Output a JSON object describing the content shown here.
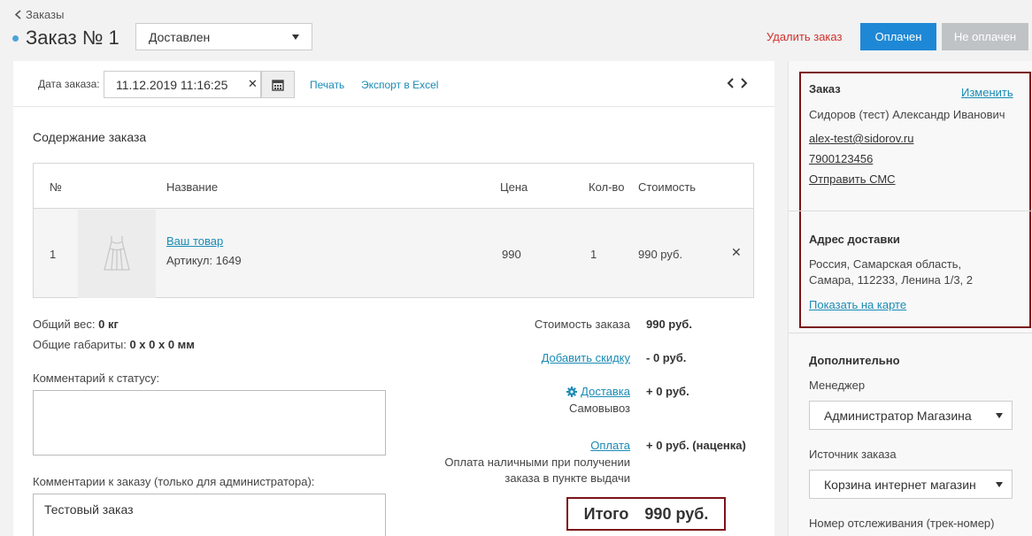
{
  "header": {
    "back_label": "Заказы",
    "title": "Заказ № 1",
    "status_value": "Доставлен",
    "delete_label": "Удалить заказ",
    "paid_label": "Оплачен",
    "unpaid_label": "Не оплачен"
  },
  "toolbar": {
    "date_label": "Дата заказа:",
    "date_value": "11.12.2019 11:16:25",
    "clear_glyph": "✕",
    "print_label": "Печать",
    "excel_label": "Экспорт в Excel"
  },
  "items": {
    "section_title": "Содержание заказа",
    "columns": [
      "№",
      "Название",
      "Цена",
      "Кол-во",
      "Стоимость"
    ],
    "rows": [
      {
        "num": "1",
        "name": "Ваш товар",
        "sku": "Артикул: 1649",
        "price": "990",
        "qty": "1",
        "cost": "990 руб."
      }
    ],
    "remove_glyph": "✕"
  },
  "meta": {
    "weight_label": "Общий вес:",
    "weight_value": "0 кг",
    "dims_label": "Общие габариты:",
    "dims_value": "0 x 0 x 0 мм",
    "status_comment_label": "Комментарий к статусу:",
    "admin_comment_label": "Комментарии к заказу (только для администратора):",
    "admin_comment_value": "Тестовый заказ"
  },
  "summary": {
    "order_cost_label": "Стоимость заказа",
    "order_cost_value": "990 руб.",
    "discount_label": "Добавить скидку",
    "discount_value": "- 0 руб.",
    "delivery_label": "Доставка",
    "delivery_value": "+ 0 руб.",
    "delivery_method": "Самовывоз",
    "payment_label": "Оплата",
    "payment_value": "+ 0 руб. (наценка)",
    "payment_method_line1": "Оплата наличными при получении",
    "payment_method_line2": "заказа в пункте выдачи",
    "total_label": "Итого",
    "total_value": "990 руб."
  },
  "customer": {
    "head": "Заказ",
    "edit_label": "Изменить",
    "name": "Сидоров (тест) Александр Иванович",
    "email": "alex-test@sidorov.ru",
    "phone": "7900123456",
    "sms_label": "Отправить СМС"
  },
  "address": {
    "head": "Адрес доставки",
    "line1": "Россия, Самарская область,",
    "line2": "Самара, 112233, Ленина 1/3, 2",
    "map_label": "Показать на карте"
  },
  "extra": {
    "head": "Дополнительно",
    "manager_label": "Менеджер",
    "manager_value": "Администратор Магазина",
    "source_label": "Источник заказа",
    "source_value": "Корзина интернет магазин",
    "tracking_label": "Номер отслеживания (трек-номер)"
  },
  "colors": {
    "accent": "#1e88d6",
    "link": "#1a8bb5",
    "danger": "#d0312d",
    "highlight_border": "#7b1418"
  }
}
